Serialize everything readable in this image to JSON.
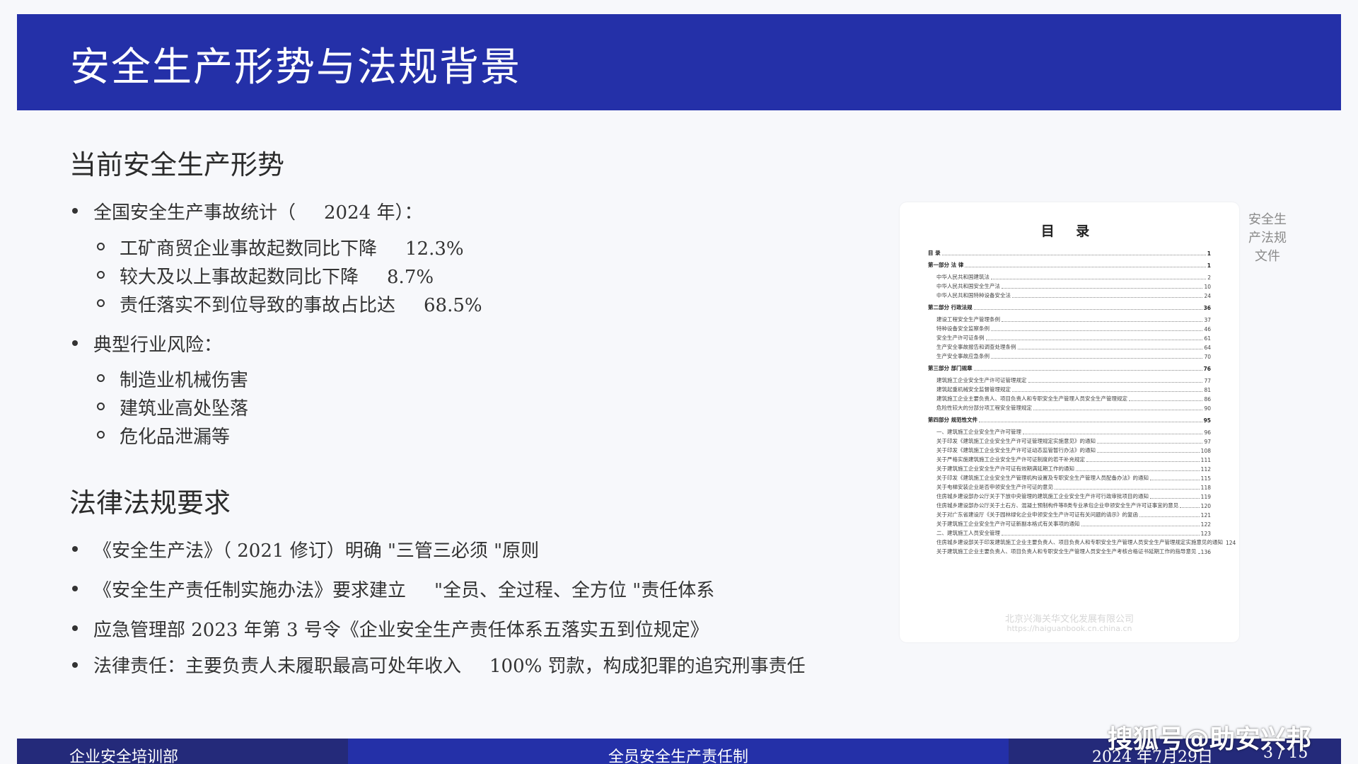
{
  "title": "安全生产形势与法规背景",
  "sections": [
    {
      "heading": "当前安全生产形势",
      "items": [
        {
          "text": "全国安全生产事故统计（",
          "value": "2024 年）：",
          "children": [
            {
              "text": "工矿商贸企业事故起数同比下降",
              "value": "12.3%"
            },
            {
              "text": "较大及以上事故起数同比下降",
              "value": "8.7%"
            },
            {
              "text": "责任落实不到位导致的事故占比达",
              "value": "68.5%"
            }
          ]
        },
        {
          "text": "典型行业风险：",
          "children": [
            {
              "text": "制造业机械伤害"
            },
            {
              "text": "建筑业高处坠落"
            },
            {
              "text": "危化品泄漏等"
            }
          ]
        }
      ]
    },
    {
      "heading": "法律法规要求",
      "items": [
        {
          "text": "《安全生产法》（ 2021 修订）明确 \"三管三必须 \"原则"
        },
        {
          "text": "《安全生产责任制实施办法》要求建立",
          "value": "\"全员、全过程、全方位 \"责任体系"
        },
        {
          "text": "应急管理部  2023 年第 3 号令《企业安全生产责任体系五落实五到位规定》"
        },
        {
          "text": "法律责任：主要负责人未履职最高可处年收入",
          "value": "100% 罚款，构成犯罪的追究刑事责任"
        }
      ]
    }
  ],
  "document_image": {
    "caption": "安全生产法规文件",
    "title": "目 录",
    "toc": [
      {
        "text": "目 录",
        "page": "1",
        "bold": true
      },
      {
        "text": "第一部分  法 律",
        "page": "1",
        "bold": true
      },
      {
        "text": "中华人民共和国建筑法",
        "page": "2"
      },
      {
        "text": "中华人民共和国安全生产法",
        "page": "10"
      },
      {
        "text": "中华人民共和国特种设备安全法",
        "page": "24"
      },
      {
        "text": "第二部分  行政法规",
        "page": "36",
        "bold": true
      },
      {
        "text": "建设工程安全生产管理条例",
        "page": "37"
      },
      {
        "text": "特种设备安全监察条例",
        "page": "46"
      },
      {
        "text": "安全生产许可证条例",
        "page": "61"
      },
      {
        "text": "生产安全事故报告和调查处理条例",
        "page": "64"
      },
      {
        "text": "生产安全事故应急条例",
        "page": "70"
      },
      {
        "text": "第三部分  部门规章",
        "page": "76",
        "bold": true
      },
      {
        "text": "建筑施工企业安全生产许可证管理规定",
        "page": "77"
      },
      {
        "text": "建筑起重机械安全监督管理规定",
        "page": "81"
      },
      {
        "text": "建筑施工企业主要负责人、项目负责人和专职安全生产管理人员安全生产管理规定",
        "page": "86"
      },
      {
        "text": "危险性较大的分部分项工程安全管理规定",
        "page": "90"
      },
      {
        "text": "第四部分  规范性文件",
        "page": "95",
        "bold": true
      },
      {
        "text": "一、建筑施工企业安全生产许可管理",
        "page": "96"
      },
      {
        "text": "关于印发《建筑施工企业安全生产许可证管理规定实施意见》的通知",
        "page": "97"
      },
      {
        "text": "关于印发《建筑施工企业安全生产许可证动态监管暂行办法》的通知",
        "page": "108"
      },
      {
        "text": "关于严格实施建筑施工企业安全生产许可证制度的若干补充规定",
        "page": "111"
      },
      {
        "text": "关于建筑施工企业安全生产许可证有效期满延期工作的通知",
        "page": "112"
      },
      {
        "text": "关于印发《建筑施工企业安全生产管理机构设置及专职安全生产管理人员配备办法》的通知",
        "page": "115"
      },
      {
        "text": "关于电梯安装企业是否申领安全生产许可证的意见",
        "page": "118"
      },
      {
        "text": "住房城乡建设部办公厅关于下放中央管理的建筑施工企业安全生产许可行政审批项目的通知",
        "page": "119"
      },
      {
        "text": "住房城乡建设部办公厅关于土石方、混凝土预制构件等8类专业承包企业申领安全生产许可证事宜的意见",
        "page": "120"
      },
      {
        "text": "关于对广东省建设厅《关于园林绿化企业申领安全生产许可证有关问题的请示》的复函",
        "page": "121"
      },
      {
        "text": "关于建筑施工企业安全生产许可证新副本格式有关事项的通知",
        "page": "122"
      },
      {
        "text": "二、建筑施工人员安全管理",
        "page": "123"
      },
      {
        "text": "住房城乡建设部关于印发建筑施工企业主要负责人、项目负责人和专职安全生产管理人员安全生产管理规定实施意见的通知",
        "page": "124"
      },
      {
        "text": "关于建筑施工企业主要负责人、项目负责人和专职安全生产管理人员安全生产考核合格证书延期工作的指导意见",
        "page": "136"
      }
    ],
    "watermark_name": "北京兴海关华文化发展有限公司",
    "watermark_url": "https://haiguanbook.cn.china.cn"
  },
  "footer": {
    "left": "企业安全培训部",
    "center": "全员安全生产责任制",
    "date": "2024 年7月29日",
    "page": "3 / 15"
  },
  "brand_watermark": "搜狐号@助安兴邦",
  "colors": {
    "header": "#2430a8",
    "footer_dark": "#242a7a",
    "background": "#f7f8fb"
  }
}
